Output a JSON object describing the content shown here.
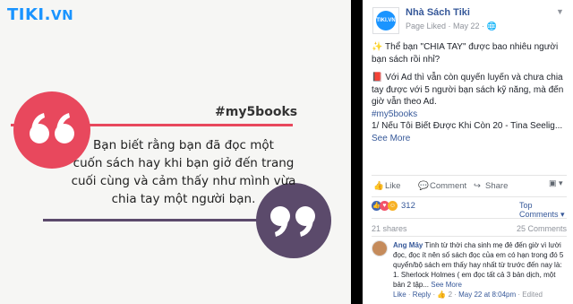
{
  "photo": {
    "logo_text": "TIKI",
    "logo_dot": ".",
    "logo_suffix": "VN",
    "hashtag": "#my5books",
    "quote_lines": [
      "Bạn biết rằng bạn đã đọc một",
      "cuốn sách hay khi bạn giở đến trang",
      "cuối cùng và cảm thấy như mình vừa",
      "chia tay một người bạn."
    ],
    "quote_open_glyph": "“",
    "quote_close_glyph": "”"
  },
  "post": {
    "page_name": "Nhà Sách Tiki",
    "page_meta": "Page Liked · May 22 · ",
    "avatar_text": "TIKI.VN",
    "paragraph1_emoji": "✨",
    "paragraph1": " Thể bạn \"CHIA TAY\" được bao nhiêu người bạn sách rồi nhỉ?",
    "paragraph2_emoji": "📕",
    "paragraph2": " Với Ad thì vẫn còn quyến luyến và chưa chia tay được với 5 người bạn sách kỹ năng, mà đến giờ vẫn theo Ad.",
    "hashtag": "#my5books",
    "book_line": "1/ Nếu Tôi Biết Được Khi Còn 20 - Tina Seelig...",
    "see_more": "See More"
  },
  "actions": {
    "like": "Like",
    "comment": "Comment",
    "share": "Share"
  },
  "reactions": {
    "count": "312",
    "top_comments": "Top Comments ▾"
  },
  "stats": {
    "shares": "21 shares",
    "comments": "25 Comments"
  },
  "comment": {
    "author": "Ang Mây",
    "text": " Tình từ thời cha sinh mẹ đẻ đến giờ vì lười đọc, đọc ít nên số sách đọc của em có hạn trong đó 5 quyển/bộ sách em thấy hay nhất từ trước đến nay là: 1. Sherlock Holmes ( em đọc tất cả 3 bản dịch, một bản 2 tập...",
    "see_more": " See More",
    "like": "Like",
    "reply": "Reply",
    "sep": " · ",
    "like_count": "2",
    "date": "May 22 at 8:04pm",
    "edited": "Edited"
  },
  "colors": {
    "accent_red": "#e8485d",
    "accent_purple": "#5b4a6b",
    "fb_link": "#365899",
    "tiki_blue": "#1a94ff"
  }
}
